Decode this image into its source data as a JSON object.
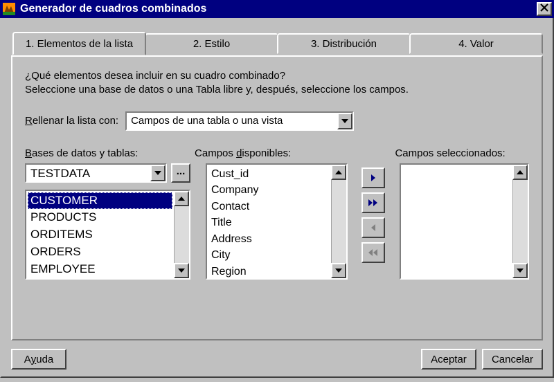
{
  "window": {
    "title": "Generador de cuadros combinados"
  },
  "tabs": {
    "t1": "1. Elementos de la lista",
    "t2": "2. Estilo",
    "t3": "3. Distribución",
    "t4": "4. Valor"
  },
  "intro": {
    "line1": "¿Qué elementos desea incluir en su cuadro combinado?",
    "line2": "Seleccione una base de datos o una Tabla libre y, después, seleccione los campos."
  },
  "fill": {
    "label_pre": "R",
    "label_post": "ellenar la lista con:",
    "value": "Campos de una tabla o una vista"
  },
  "db": {
    "label_pre": "B",
    "label_post": "ases de datos y tablas:",
    "combo_value": "TESTDATA",
    "ellipsis": "...",
    "tables": [
      "CUSTOMER",
      "PRODUCTS",
      "ORDITEMS",
      "ORDERS",
      "EMPLOYEE"
    ]
  },
  "avail": {
    "label": "Campos disponibles:",
    "fields": [
      "Cust_id",
      "Company",
      "Contact",
      "Title",
      "Address",
      "City",
      "Region"
    ]
  },
  "sel": {
    "label": "Campos seleccionados:"
  },
  "buttons": {
    "help": "Ayuda",
    "ok": "Aceptar",
    "cancel": "Cancelar"
  }
}
